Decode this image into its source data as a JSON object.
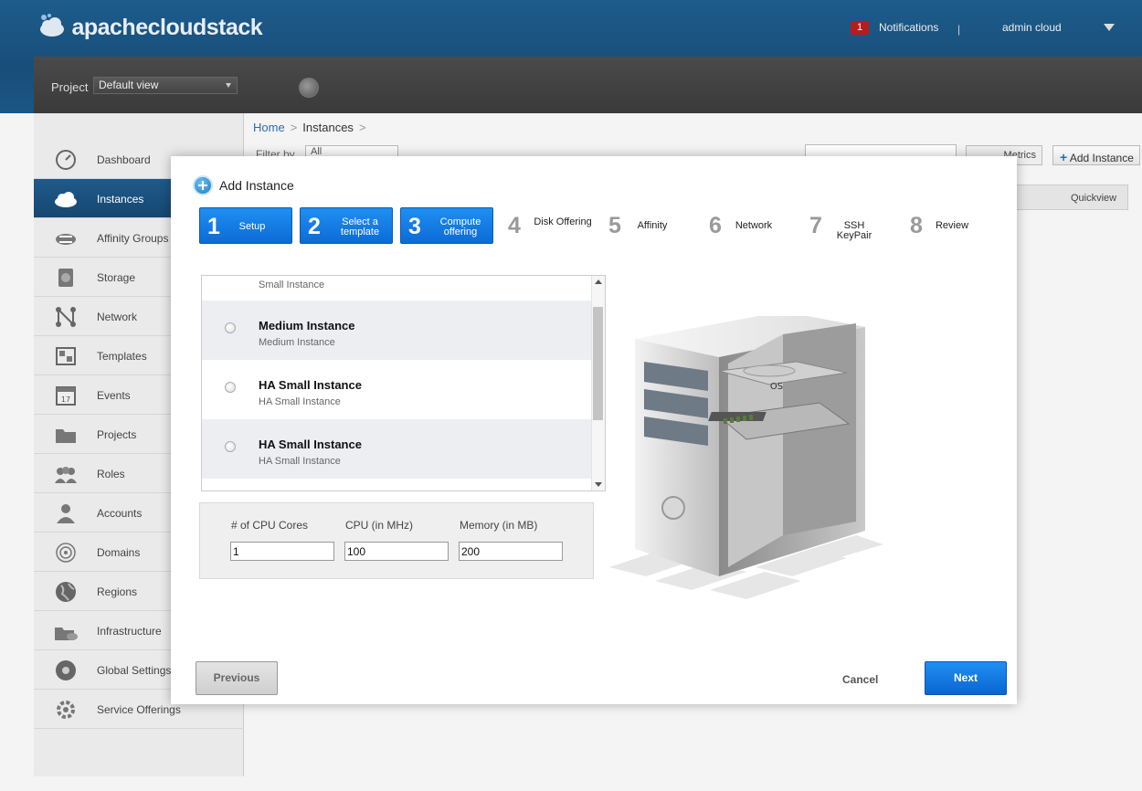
{
  "header": {
    "logo_text": "apachecloudstack",
    "notifications_count": "1",
    "notifications_label": "Notifications",
    "separator": "|",
    "user_name": "admin cloud"
  },
  "project_bar": {
    "label": "Project",
    "selected": "Default view"
  },
  "sidebar": {
    "items": [
      {
        "label": "Dashboard",
        "icon": "dashboard-icon"
      },
      {
        "label": "Instances",
        "icon": "cloud-icon",
        "active": true
      },
      {
        "label": "Affinity Groups",
        "icon": "affinity-icon"
      },
      {
        "label": "Storage",
        "icon": "storage-icon"
      },
      {
        "label": "Network",
        "icon": "network-icon"
      },
      {
        "label": "Templates",
        "icon": "templates-icon"
      },
      {
        "label": "Events",
        "icon": "calendar-icon"
      },
      {
        "label": "Projects",
        "icon": "folder-icon"
      },
      {
        "label": "Roles",
        "icon": "roles-icon"
      },
      {
        "label": "Accounts",
        "icon": "user-icon"
      },
      {
        "label": "Domains",
        "icon": "domains-icon"
      },
      {
        "label": "Regions",
        "icon": "globe-icon"
      },
      {
        "label": "Infrastructure",
        "icon": "infrastructure-icon"
      },
      {
        "label": "Global Settings",
        "icon": "settings-globe-icon"
      },
      {
        "label": "Service Offerings",
        "icon": "gear-icon"
      }
    ]
  },
  "main": {
    "breadcrumb": {
      "home": "Home",
      "current": "Instances",
      "sep": ">"
    },
    "filter_label": "Filter by",
    "filter_value": "All",
    "metrics_label": "Metrics",
    "add_instance_label": "Add Instance",
    "quickview_label": "Quickview"
  },
  "dialog": {
    "title": "Add Instance",
    "steps": [
      {
        "num": "1",
        "label": "Setup",
        "state": "done"
      },
      {
        "num": "2",
        "label": "Select a template",
        "state": "done"
      },
      {
        "num": "3",
        "label": "Compute offering",
        "state": "done"
      },
      {
        "num": "4",
        "label": "Disk Offering",
        "state": "todo"
      },
      {
        "num": "5",
        "label": "Affinity",
        "state": "todo"
      },
      {
        "num": "6",
        "label": "Network",
        "state": "todo"
      },
      {
        "num": "7",
        "label": "SSH KeyPair",
        "state": "todo"
      },
      {
        "num": "8",
        "label": "Review",
        "state": "todo"
      }
    ],
    "offerings": [
      {
        "name": "",
        "desc": "Small Instance"
      },
      {
        "name": "Medium Instance",
        "desc": "Medium Instance"
      },
      {
        "name": "HA Small Instance",
        "desc": "HA Small Instance"
      },
      {
        "name": "HA Small Instance",
        "desc": "HA Small Instance"
      }
    ],
    "custom": {
      "cpu_cores_label": "# of CPU Cores",
      "cpu_cores_value": "1",
      "cpu_mhz_label": "CPU (in MHz)",
      "cpu_mhz_value": "100",
      "memory_label": "Memory (in MB)",
      "memory_value": "200"
    },
    "server_os_label": "OS",
    "previous_label": "Previous",
    "cancel_label": "Cancel",
    "next_label": "Next"
  },
  "colors": {
    "header_blue": "#1d5c8c",
    "step_done": "#1f8ff2",
    "next_button": "#0b65d2",
    "badge_red": "#b51d1d"
  }
}
